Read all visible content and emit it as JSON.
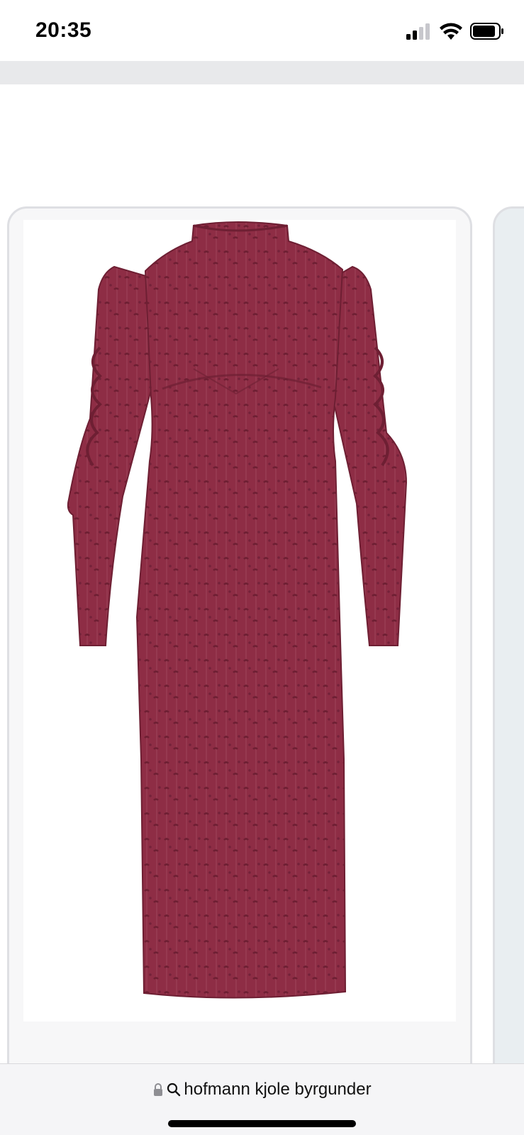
{
  "status_bar": {
    "time": "20:35",
    "signal_icon": "signal-icon",
    "wifi_icon": "wifi-icon",
    "battery_icon": "battery-icon"
  },
  "product": {
    "image_icon": "burgundy-dress-image",
    "dress_color": "#8e2d45"
  },
  "address_bar": {
    "lock_icon": "lock-icon",
    "search_icon": "search-icon",
    "query": "hofmann kjole byrgunder"
  }
}
